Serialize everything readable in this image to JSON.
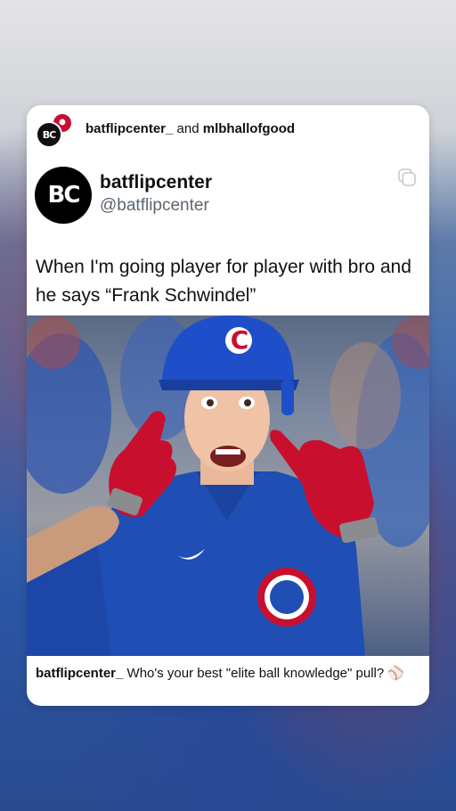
{
  "collab": {
    "user1": "batflipcenter_",
    "joiner": "and",
    "user2": "mlbhallofgood",
    "avatar_text": "BC"
  },
  "tweet": {
    "avatar_text": "BC",
    "display_name": "batflipcenter",
    "handle": "@batflipcenter",
    "text": "When I'm going player for player with bro and he says “Frank Schwindel”"
  },
  "photo": {
    "helmet_logo": "C"
  },
  "caption": {
    "username": "batflipcenter_",
    "text": "Who's your best \"elite ball knowledge\" pull?",
    "emoji": "⚾"
  }
}
